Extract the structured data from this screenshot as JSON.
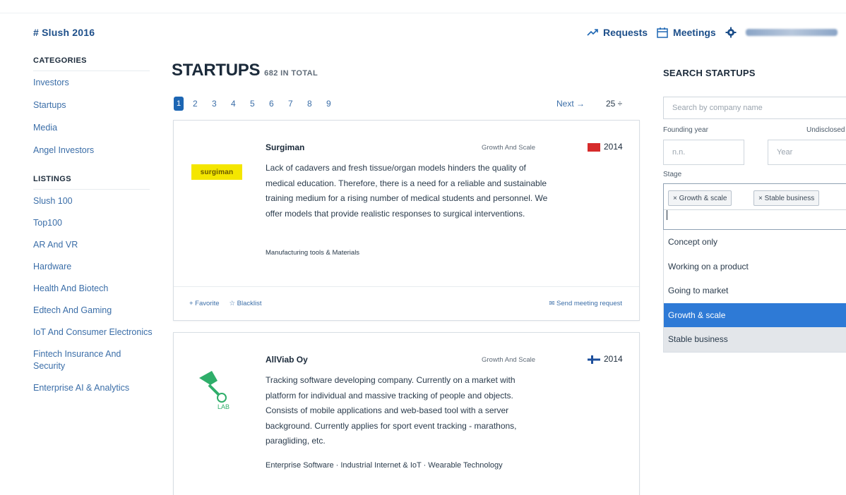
{
  "brand": "# Slush 2016",
  "topnav": {
    "requests": "Requests",
    "meetings": "Meetings"
  },
  "sidebar": {
    "categories_heading": "CATEGORIES",
    "categories": [
      "Investors",
      "Startups",
      "Media",
      "Angel Investors"
    ],
    "listings_heading": "LISTINGS",
    "listings": [
      "Slush 100",
      "Top100",
      "AR And VR",
      "Hardware",
      "Health And Biotech",
      "Edtech And Gaming",
      "IoT And Consumer Electronics",
      "Fintech Insurance And Security",
      "Enterprise AI & Analytics"
    ]
  },
  "main": {
    "title": "STARTUPS",
    "subtitle": "682 IN TOTAL",
    "pages": [
      "1",
      "2",
      "3",
      "4",
      "5",
      "6",
      "7",
      "8",
      "9"
    ],
    "next": "Next →",
    "per_page": "25 ÷"
  },
  "cards": [
    {
      "name": "Surgiman",
      "logo_text": "surgiman",
      "stage": "Growth And Scale",
      "year": "2014",
      "flag_color": "#d62b2b",
      "description": "Lack of cadavers and fresh tissue/organ models hinders the quality of medical education. Therefore, there is a need for a reliable and sustainable training medium for a rising number of medical students and personnel. We offer models that provide realistic responses to surgical interventions.",
      "tags": "Manufacturing tools & Materials",
      "footer_left": [
        "+ Favorite",
        "☆ Blacklist"
      ],
      "footer_right": "✉ Send meeting request"
    },
    {
      "name": "AllViab Oy",
      "stage": "Growth And Scale",
      "year": "2014",
      "flag_color": "#1d4f9c",
      "description": "Tracking software developing company. Currently on a market with platform for individual and massive tracking of people and objects. Consists of mobile applications and web-based tool with a server background. Currently applies for sport event tracking - marathons, paragliding, etc.",
      "tags": "Enterprise Software · Industrial Internet & IoT · Wearable Technology"
    }
  ],
  "search": {
    "heading": "SEARCH STARTUPS",
    "placeholder": "Search by company name",
    "founding_label": "Founding year",
    "undisclosed_label": "Undisclosed",
    "from_placeholder": "n.n.",
    "to_placeholder": "Year",
    "stage_label": "Stage",
    "chips": [
      "× Growth & scale",
      "× Stable business"
    ],
    "options": [
      "Concept only",
      "Working on a product",
      "Going to market",
      "Growth & scale",
      "Stable business"
    ]
  }
}
